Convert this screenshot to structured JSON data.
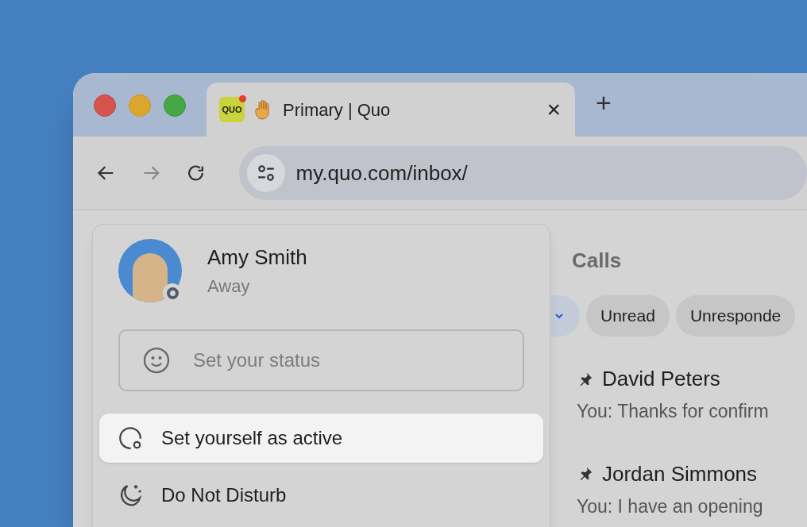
{
  "browser": {
    "tab": {
      "title": "Primary | Quo",
      "favicon_text": "QUO",
      "unread": true,
      "selected": true
    },
    "new_tab": "+",
    "close": "×",
    "url": "my.quo.com/inbox/",
    "forward_enabled": false
  },
  "page": {
    "tabs": [
      {
        "label": "Calls",
        "selected": false
      }
    ],
    "filters": [
      {
        "label": "Unread",
        "selected": false
      },
      {
        "label": "Unresponde",
        "selected": false
      }
    ],
    "conversations": [
      {
        "name": "David Peters",
        "preview": "You: Thanks for confirm",
        "pinned": true
      },
      {
        "name": "Jordan Simmons",
        "preview": "You: I have an opening",
        "pinned": true
      }
    ]
  },
  "status_menu": {
    "user": {
      "name": "Amy Smith",
      "status": "Away"
    },
    "status_field": {
      "placeholder": "Set your status"
    },
    "items": [
      {
        "kind": "active",
        "label": "Set yourself as active",
        "selected": true
      },
      {
        "kind": "dnd",
        "label": "Do Not Disturb",
        "selected": false
      }
    ]
  }
}
